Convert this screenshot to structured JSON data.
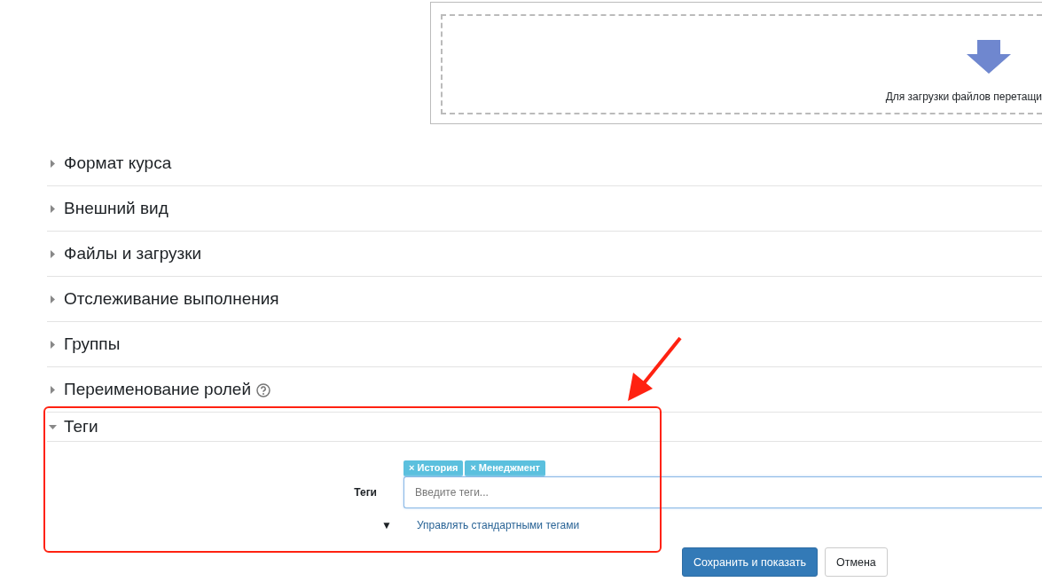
{
  "file_drop": {
    "hint": "Для загрузки файлов перетащи"
  },
  "sections": [
    {
      "title": "Формат курса",
      "expanded": false,
      "help": false
    },
    {
      "title": "Внешний вид",
      "expanded": false,
      "help": false
    },
    {
      "title": "Файлы и загрузки",
      "expanded": false,
      "help": false
    },
    {
      "title": "Отслеживание выполнения",
      "expanded": false,
      "help": false
    },
    {
      "title": "Группы",
      "expanded": false,
      "help": false
    },
    {
      "title": "Переименование ролей",
      "expanded": false,
      "help": true
    },
    {
      "title": "Теги",
      "expanded": true,
      "help": false
    }
  ],
  "tags_field": {
    "label": "Теги",
    "placeholder": "Введите теги...",
    "tags": [
      {
        "remove": "×",
        "label": "История"
      },
      {
        "remove": "×",
        "label": "Менеджмент"
      }
    ],
    "toggle": "▼",
    "link": "Управлять стандартными тегами"
  },
  "buttons": [
    {
      "label": "Сохранить и показать",
      "kind": "primary"
    },
    {
      "label": "Отмена",
      "kind": "secondary"
    }
  ]
}
